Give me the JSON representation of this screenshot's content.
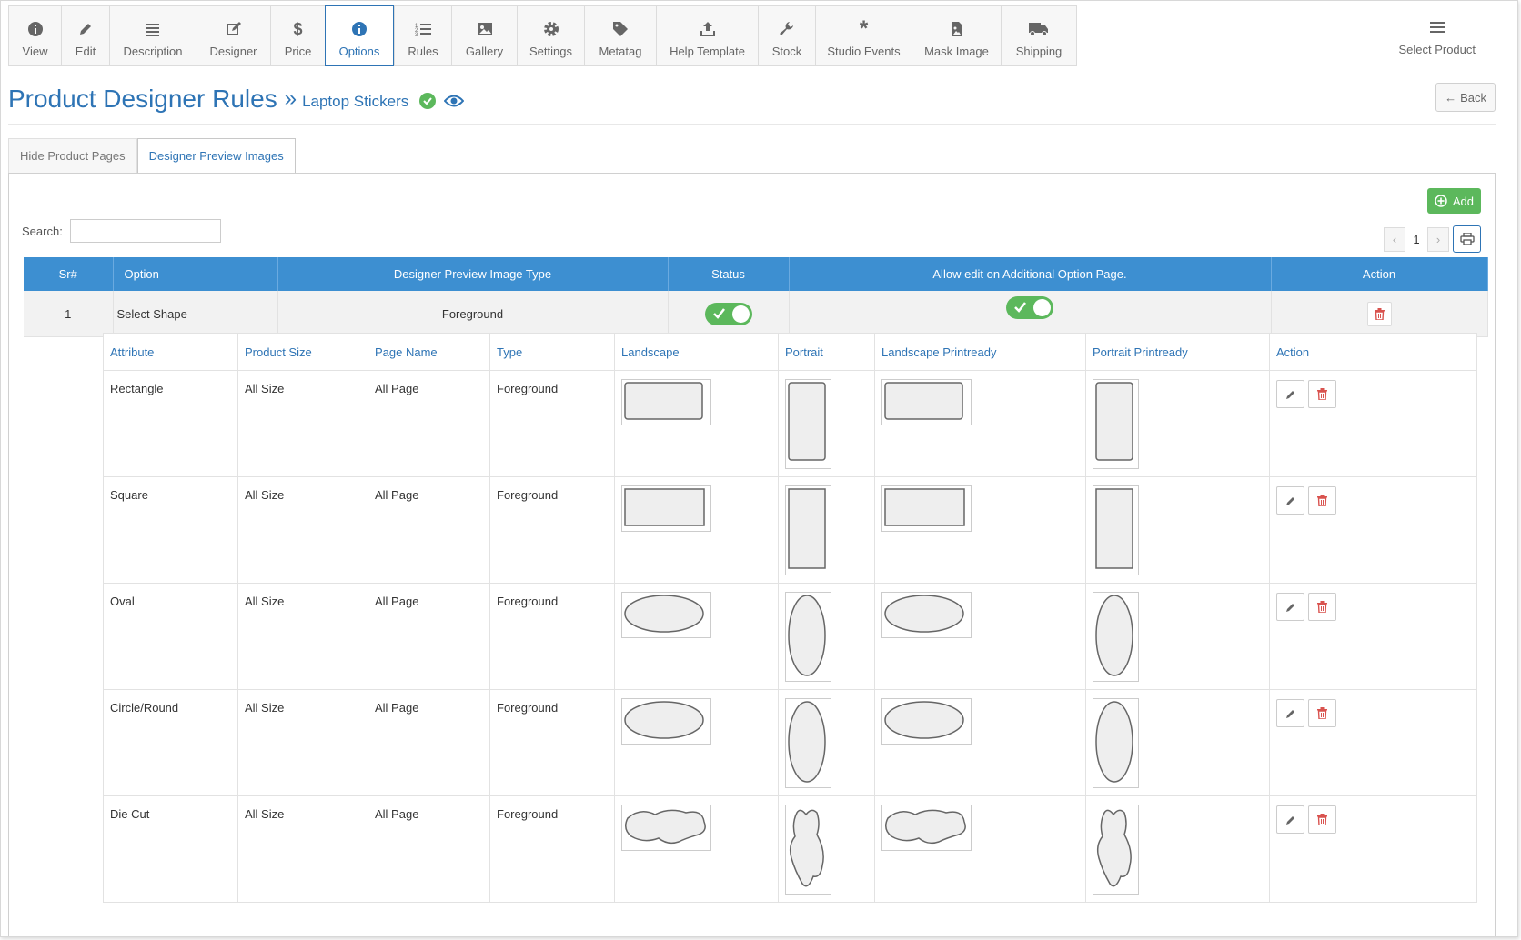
{
  "toolbar": {
    "items": [
      {
        "label": "View",
        "icon": "info-circle-icon"
      },
      {
        "label": "Edit",
        "icon": "pencil-icon"
      },
      {
        "label": "Description",
        "icon": "list-icon"
      },
      {
        "label": "Designer",
        "icon": "edit-square-icon"
      },
      {
        "label": "Price",
        "icon": "dollar-icon"
      },
      {
        "label": "Options",
        "icon": "info-circle-icon",
        "active": true
      },
      {
        "label": "Rules",
        "icon": "ordered-list-icon"
      },
      {
        "label": "Gallery",
        "icon": "image-icon"
      },
      {
        "label": "Settings",
        "icon": "gear-icon"
      },
      {
        "label": "Metatag",
        "icon": "tag-icon"
      },
      {
        "label": "Help Template",
        "icon": "upload-icon"
      },
      {
        "label": "Stock",
        "icon": "wrench-icon"
      },
      {
        "label": "Studio Events",
        "icon": "asterisk-icon"
      },
      {
        "label": "Mask Image",
        "icon": "file-image-icon"
      },
      {
        "label": "Shipping",
        "icon": "truck-icon"
      }
    ],
    "select_product": "Select Product"
  },
  "header": {
    "title": "Product Designer Rules",
    "separator": "»",
    "product": "Laptop Stickers",
    "back_label": "Back"
  },
  "tabs": [
    {
      "label": "Hide Product Pages"
    },
    {
      "label": "Designer Preview Images",
      "active": true
    }
  ],
  "panel": {
    "add_label": "Add",
    "search_label": "Search:",
    "search_value": "",
    "page": "1"
  },
  "main_table": {
    "headers": [
      "Sr#",
      "Option",
      "Designer Preview Image Type",
      "Status",
      "Allow edit on Additional Option Page.",
      "Action"
    ],
    "rows": [
      {
        "sr": "1",
        "option": "Select Shape",
        "type": "Foreground",
        "status": "on",
        "allow_edit": "on"
      }
    ]
  },
  "sub_table": {
    "headers": [
      "Attribute",
      "Product Size",
      "Page Name",
      "Type",
      "Landscape",
      "Portrait",
      "Landscape Printready",
      "Portrait Printready",
      "Action"
    ],
    "rows": [
      {
        "attribute": "Rectangle",
        "size": "All Size",
        "page": "All Page",
        "type": "Foreground",
        "shape": "rect"
      },
      {
        "attribute": "Square",
        "size": "All Size",
        "page": "All Page",
        "type": "Foreground",
        "shape": "square"
      },
      {
        "attribute": "Oval",
        "size": "All Size",
        "page": "All Page",
        "type": "Foreground",
        "shape": "oval"
      },
      {
        "attribute": "Circle/Round",
        "size": "All Size",
        "page": "All Page",
        "type": "Foreground",
        "shape": "oval"
      },
      {
        "attribute": "Die Cut",
        "size": "All Size",
        "page": "All Page",
        "type": "Foreground",
        "shape": "diecut"
      }
    ]
  },
  "colors": {
    "accent": "#2e74b5",
    "header_bg": "#3d8fd1",
    "success": "#5cb85c",
    "danger": "#d9534f"
  }
}
